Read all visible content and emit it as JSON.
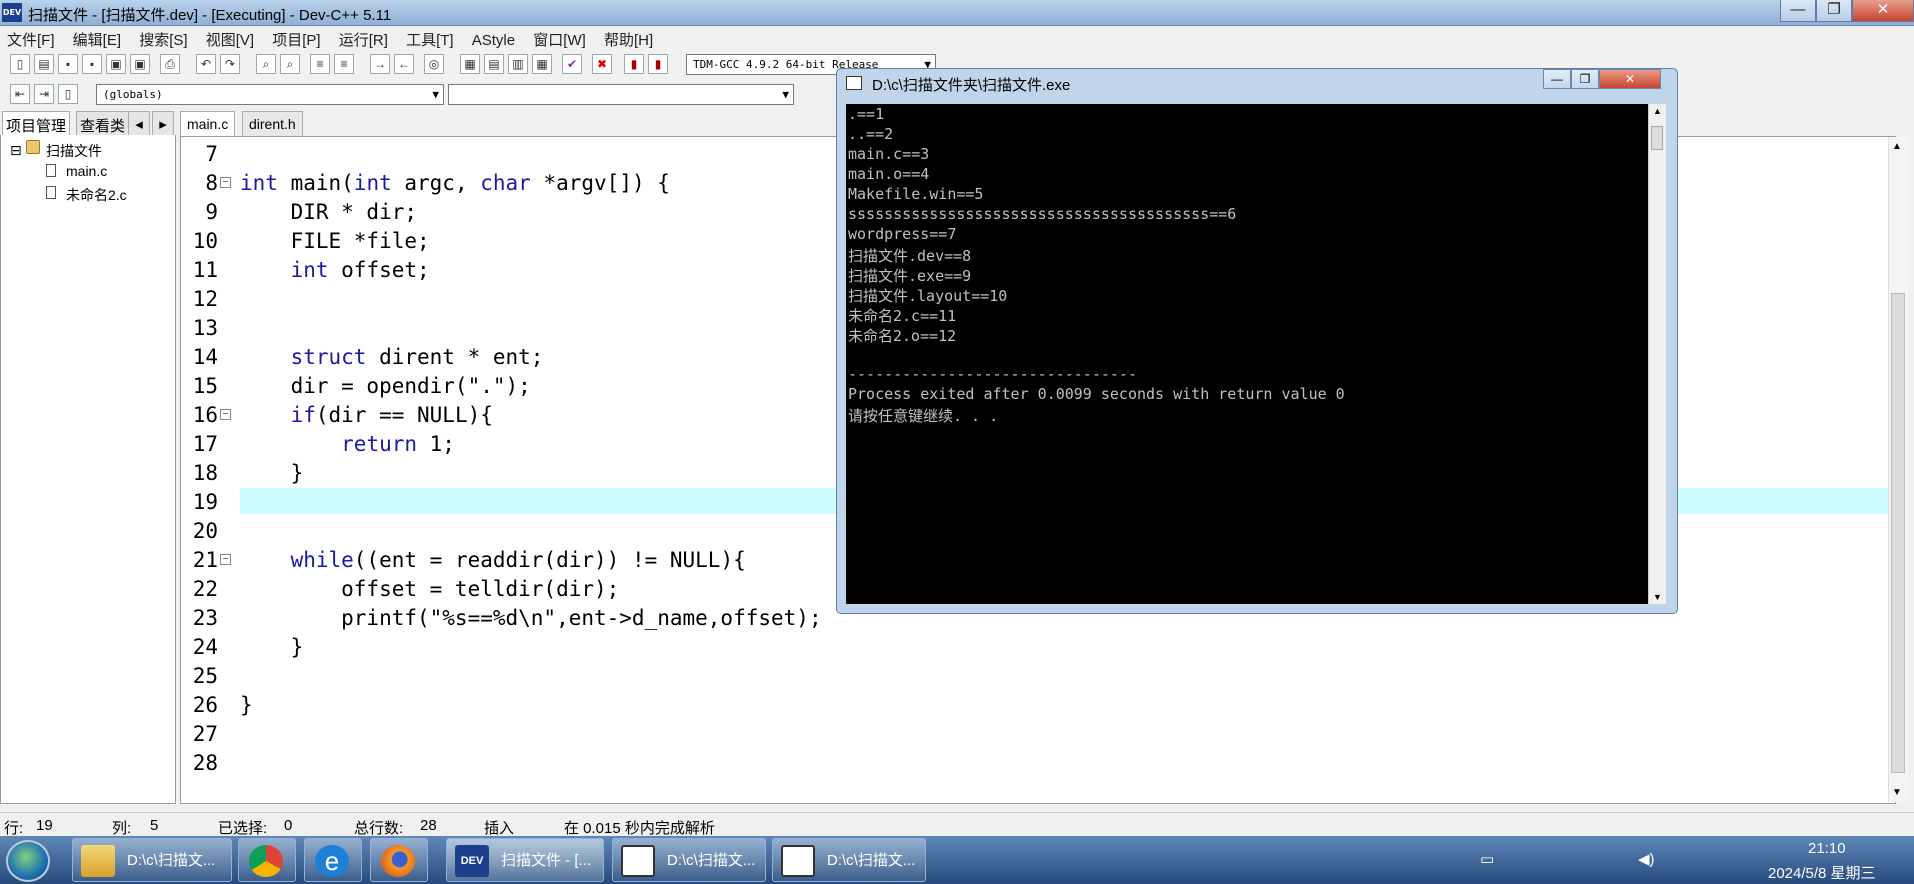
{
  "window": {
    "title": "扫描文件 - [扫描文件.dev] - [Executing] - Dev-C++ 5.11",
    "app_icon": "DEV"
  },
  "window_buttons": {
    "minimize": "—",
    "maximize": "❐",
    "close": "✕"
  },
  "menu": [
    "文件[F]",
    "编辑[E]",
    "搜索[S]",
    "视图[V]",
    "项目[P]",
    "运行[R]",
    "工具[T]",
    "AStyle",
    "窗口[W]",
    "帮助[H]"
  ],
  "toolbar": {
    "compiler": "TDM-GCC 4.9.2 64-bit Release",
    "scope": "(globals)",
    "symbol": ""
  },
  "left_panel": {
    "tabs": [
      "项目管理",
      "查看类"
    ],
    "tree": {
      "project": "扫描文件",
      "files": [
        "main.c",
        "未命名2.c"
      ]
    }
  },
  "editor": {
    "tabs": [
      "main.c",
      "dirent.h"
    ],
    "lines": [
      {
        "n": "7",
        "code": ""
      },
      {
        "n": "8",
        "code": "int main(int argc, char *argv[]) {",
        "fold": true
      },
      {
        "n": "9",
        "code": "    DIR * dir;"
      },
      {
        "n": "10",
        "code": "    FILE *file;"
      },
      {
        "n": "11",
        "code": "    int offset;"
      },
      {
        "n": "12",
        "code": ""
      },
      {
        "n": "13",
        "code": ""
      },
      {
        "n": "14",
        "code": "    struct dirent * ent;"
      },
      {
        "n": "15",
        "code": "    dir = opendir(\".\");"
      },
      {
        "n": "16",
        "code": "    if(dir == NULL){",
        "fold": true
      },
      {
        "n": "17",
        "code": "        return 1;"
      },
      {
        "n": "18",
        "code": "    }"
      },
      {
        "n": "19",
        "code": ""
      },
      {
        "n": "20",
        "code": ""
      },
      {
        "n": "21",
        "code": "    while((ent = readdir(dir)) != NULL){",
        "fold": true
      },
      {
        "n": "22",
        "code": "        offset = telldir(dir);"
      },
      {
        "n": "23",
        "code": "        printf(\"%s==%d\\n\",ent->d_name,offset);"
      },
      {
        "n": "24",
        "code": "    }"
      },
      {
        "n": "25",
        "code": ""
      },
      {
        "n": "26",
        "code": "}"
      },
      {
        "n": "27",
        "code": ""
      },
      {
        "n": "28",
        "code": ""
      }
    ]
  },
  "status": {
    "row_label": "行:",
    "row": "19",
    "col_label": "列:",
    "col": "5",
    "sel_label": "已选择:",
    "sel": "0",
    "total_label": "总行数:",
    "total": "28",
    "mode": "插入",
    "parse": "在 0.015 秒内完成解析"
  },
  "console": {
    "title": "D:\\c\\扫描文件夹\\扫描文件.exe",
    "lines": [
      ".==1",
      "..==2",
      "main.c==3",
      "main.o==4",
      "Makefile.win==5",
      "ssssssssssssssssssssssssssssssssssssssss==6",
      "wordpress==7",
      "扫描文件.dev==8",
      "扫描文件.exe==9",
      "扫描文件.layout==10",
      "未命名2.c==11",
      "未命名2.o==12",
      "",
      "--------------------------------",
      "Process exited after 0.0099 seconds with return value 0",
      "请按任意键继续. . ."
    ]
  },
  "taskbar": {
    "items": [
      "D:\\c\\扫描文...",
      "扫描文件 - [...",
      "D:\\c\\扫描文...",
      "D:\\c\\扫描文..."
    ],
    "time": "21:10",
    "date": "2024/5/8 星期三"
  }
}
